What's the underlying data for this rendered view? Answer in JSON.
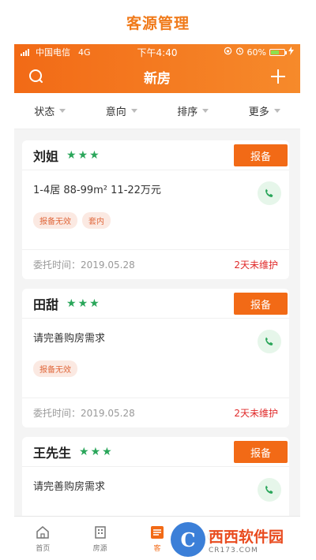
{
  "banner": {
    "title": "客源管理"
  },
  "status_bar": {
    "carrier": "中国电信",
    "network": "4G",
    "time": "下午4:40",
    "battery": "60%",
    "battery_level": 0.6
  },
  "header": {
    "title": "新房",
    "search_icon": "search-icon",
    "add_icon": "plus-icon"
  },
  "filters": [
    {
      "label": "状态"
    },
    {
      "label": "意向"
    },
    {
      "label": "排序"
    },
    {
      "label": "更多"
    }
  ],
  "cards": [
    {
      "name": "刘姐",
      "stars": "★★★",
      "button": "报备",
      "info": "1-4居  88-99m²  11-22万元",
      "tags": [
        "报备无效",
        "套内"
      ],
      "date": "委托时间：2019.05.28",
      "status": "2天未维护"
    },
    {
      "name": "田甜",
      "stars": "★★★",
      "button": "报备",
      "info": "请完善购房需求",
      "tags": [
        "报备无效"
      ],
      "date": "委托时间：2019.05.28",
      "status": "2天未维护"
    },
    {
      "name": "王先生",
      "stars": "★★★",
      "button": "报备",
      "info": "请完善购房需求"
    }
  ],
  "tabbar": [
    {
      "label": "首页",
      "icon": "home-icon"
    },
    {
      "label": "房源",
      "icon": "building-icon"
    },
    {
      "label": "客",
      "icon": "list-icon",
      "active": true
    },
    {
      "label": "",
      "icon": "chat-icon"
    },
    {
      "label": "",
      "icon": "user-icon"
    }
  ],
  "watermark": {
    "logo": "C",
    "name": "西西软件园",
    "url": "CR173.COM"
  },
  "colors": {
    "accent": "#f26a16",
    "star": "#2aa65a",
    "warning": "#e02a2a",
    "tag": "#e0683c"
  }
}
